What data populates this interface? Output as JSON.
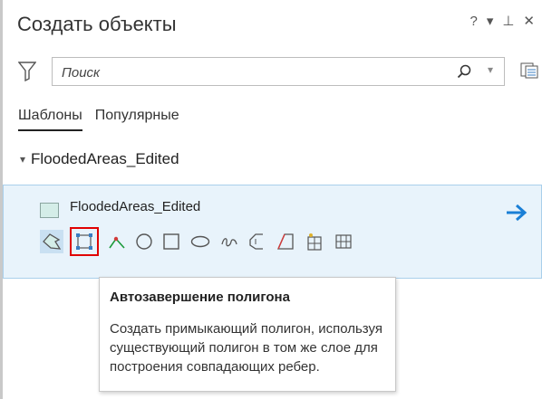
{
  "pane": {
    "title": "Создать объекты",
    "controls": {
      "help": "?",
      "menu": "▾",
      "pin": "⊥",
      "close": "✕"
    }
  },
  "search": {
    "placeholder": "Поиск",
    "value": ""
  },
  "tabs": [
    {
      "label": "Шаблоны",
      "active": true
    },
    {
      "label": "Популярные",
      "active": false
    }
  ],
  "group": {
    "name": "FloodedAreas_Edited",
    "expanded": true
  },
  "template": {
    "layer_name": "FloodedAreas_Edited",
    "swatch_color": "#d4ede8",
    "tools": [
      {
        "name": "polygon-tool",
        "selected": true
      },
      {
        "name": "autocomplete-polygon-tool",
        "highlighted": true
      },
      {
        "name": "line-tool"
      },
      {
        "name": "circle-tool"
      },
      {
        "name": "rectangle-tool"
      },
      {
        "name": "ellipse-tool"
      },
      {
        "name": "freehand-tool"
      },
      {
        "name": "right-angle-tool"
      },
      {
        "name": "trace-tool"
      },
      {
        "name": "split-tool"
      },
      {
        "name": "fill-tool"
      }
    ]
  },
  "tooltip": {
    "title": "Автозавершение полигона",
    "body": "Создать примыкающий полигон, используя существующий полигон в том же слое для построения совпадающих ребер."
  },
  "colors": {
    "accent": "#1a7fd6",
    "highlight": "#e00000",
    "selected_bg": "#e8f3fb"
  }
}
